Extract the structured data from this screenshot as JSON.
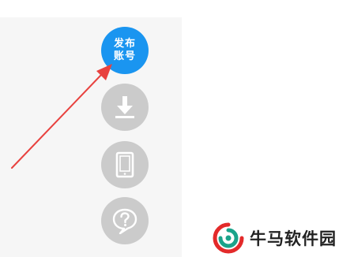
{
  "floating_toolbar": {
    "publish_button": {
      "line1": "发布",
      "line2": "账号"
    },
    "download_icon": "download-icon",
    "mobile_icon": "tablet-icon",
    "help_icon": "help-bubble-icon",
    "colors": {
      "primary": "#1a95f0",
      "inactive": "#cbcbcb",
      "arrow": "#e8423f"
    }
  },
  "watermark": {
    "text": "牛马软件园"
  }
}
